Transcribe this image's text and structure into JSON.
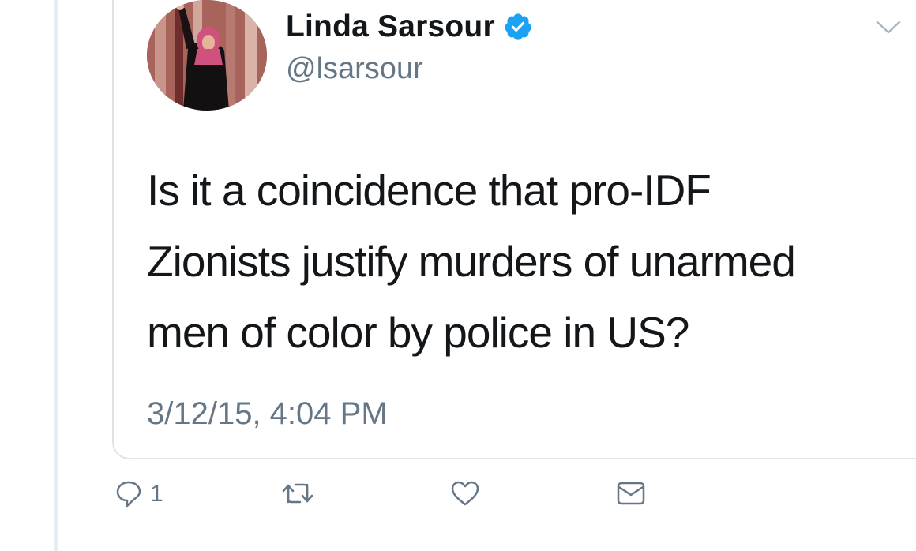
{
  "tweet": {
    "author_name": "Linda Sarsour",
    "handle": "@lsarsour",
    "text_lines": [
      "Is it a coincidence that pro-IDF",
      "Zionists justify murders of unarmed",
      "men of color by police in US?"
    ],
    "timestamp": "3/12/15, 4:04 PM"
  },
  "actions": {
    "reply_count": "1"
  },
  "colors": {
    "verified": "#1da1f2",
    "secondary_text": "#657786",
    "border": "#dfe3e6"
  },
  "icons": [
    "verified-badge-icon",
    "chevron-down-icon",
    "reply-icon",
    "retweet-icon",
    "like-icon",
    "direct-message-icon"
  ]
}
